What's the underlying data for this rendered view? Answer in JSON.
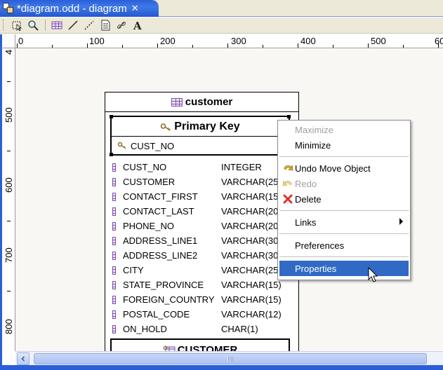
{
  "editor": {
    "tab_title": "*diagram.odd - diagram",
    "tab_close": "✕"
  },
  "toolbar": {
    "buttons": [
      "select-icon",
      "zoom-icon",
      "table-icon",
      "line-icon",
      "dashed-line-icon",
      "note-icon",
      "link-icon",
      "text-icon"
    ]
  },
  "ruler": {
    "top_labels": [
      "0",
      "100",
      "200",
      "300",
      "400",
      "500",
      "60"
    ],
    "left_labels": [
      "4",
      "500",
      "600",
      "700",
      "800"
    ]
  },
  "table": {
    "title": "customer",
    "primary_key_title": "Primary Key",
    "primary_key_column": "CUST_NO",
    "columns": [
      {
        "name": "CUST_NO",
        "type": "INTEGER"
      },
      {
        "name": "CUSTOMER",
        "type": "VARCHAR(25"
      },
      {
        "name": "CONTACT_FIRST",
        "type": "VARCHAR(15"
      },
      {
        "name": "CONTACT_LAST",
        "type": "VARCHAR(20"
      },
      {
        "name": "PHONE_NO",
        "type": "VARCHAR(20"
      },
      {
        "name": "ADDRESS_LINE1",
        "type": "VARCHAR(30"
      },
      {
        "name": "ADDRESS_LINE2",
        "type": "VARCHAR(30"
      },
      {
        "name": "CITY",
        "type": "VARCHAR(25"
      },
      {
        "name": "STATE_PROVINCE",
        "type": "VARCHAR(15)"
      },
      {
        "name": "FOREIGN_COUNTRY",
        "type": "VARCHAR(15)"
      },
      {
        "name": "POSTAL_CODE",
        "type": "VARCHAR(12)"
      },
      {
        "name": "ON_HOLD",
        "type": "CHAR(1)"
      }
    ],
    "sub_title": "CUSTOMER"
  },
  "context_menu": {
    "maximize": "Maximize",
    "minimize": "Minimize",
    "undo": "Undo Move Object",
    "redo": "Redo",
    "delete": "Delete",
    "links": "Links",
    "preferences": "Preferences",
    "properties": "Properties"
  },
  "colors": {
    "selection": "#316ac5",
    "tab_blue": "#2a5fd8",
    "table_icon": "#7a4ea8",
    "delete_red": "#e0302a"
  }
}
